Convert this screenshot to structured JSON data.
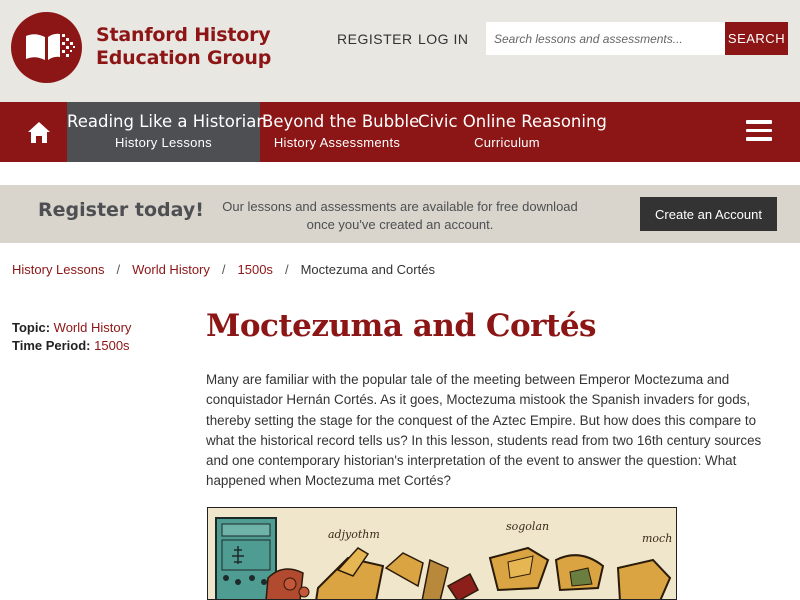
{
  "header": {
    "org_line1": "Stanford History",
    "org_line2": "Education Group",
    "register_label": "REGISTER",
    "login_label": "LOG IN",
    "search_placeholder": "Search lessons and assessments...",
    "search_button": "SEARCH"
  },
  "nav": {
    "home_icon": "home-icon",
    "items": [
      {
        "title": "Reading Like a Historian",
        "subtitle": "History Lessons",
        "active": true
      },
      {
        "title": "Beyond the Bubble",
        "subtitle": "History Assessments",
        "active": false
      },
      {
        "title": "Civic Online Reasoning",
        "subtitle": "Curriculum",
        "active": false
      }
    ],
    "menu_icon": "hamburger-menu-icon"
  },
  "banner": {
    "title": "Register today!",
    "text": "Our lessons and assessments are available for free download once you've created an account.",
    "button": "Create an Account"
  },
  "breadcrumb": {
    "items": [
      "History Lessons",
      "World History",
      "1500s"
    ],
    "current": "Moctezuma and Cortés",
    "separator": "/"
  },
  "meta": {
    "topic_label": "Topic:",
    "topic_value": "World History",
    "period_label": "Time Period:",
    "period_value": "1500s"
  },
  "main": {
    "title": "Moctezuma and Cortés",
    "intro": "Many are familiar with the popular tale of the meeting between Emperor Moctezuma and conquistador Hernán Cortés. As it goes, Moctezuma mistook the Spanish invaders for gods, thereby setting the stage for the conquest of the Aztec Empire. But how does this compare to what the historical record tells us? In this lesson, students read from two 16th century sources and one contemporary historian's interpretation of the event to answer the question: What happened when Moctezuma met Cortés?",
    "image_captions": [
      "adjyothm",
      "sogolan",
      "moch"
    ]
  },
  "colors": {
    "brand": "#8c1515",
    "header_bg": "#e9e7e2",
    "banner_bg": "#d9d5cc",
    "nav_active": "#4d4f53",
    "dark_button": "#333333"
  }
}
